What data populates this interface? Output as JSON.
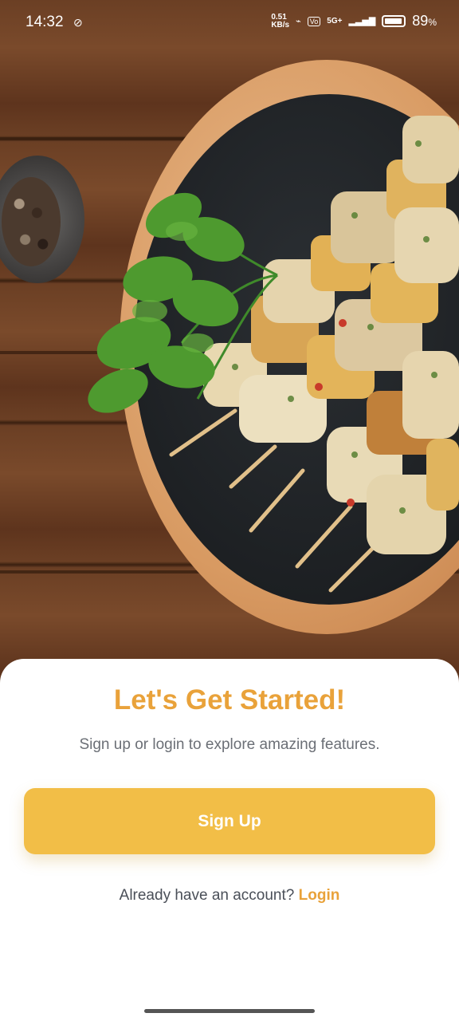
{
  "status_bar": {
    "time": "14:32",
    "network_speed": "0.51\nKB/s",
    "network_type": "5G+",
    "battery_percent": "89",
    "battery_unit": "%"
  },
  "hero": {
    "image_description_icons": [
      "pepper-bowl-icon",
      "parsley-icon",
      "skewer-icon"
    ]
  },
  "onboarding": {
    "title": "Let's Get Started!",
    "subtitle": "Sign up or login to explore amazing features.",
    "signup_label": "Sign Up",
    "login_prompt": "Already have an account?",
    "login_label": "Login"
  },
  "colors": {
    "accent": "#e9a23a",
    "button": "#f2be47",
    "sheet": "#ffffff"
  }
}
